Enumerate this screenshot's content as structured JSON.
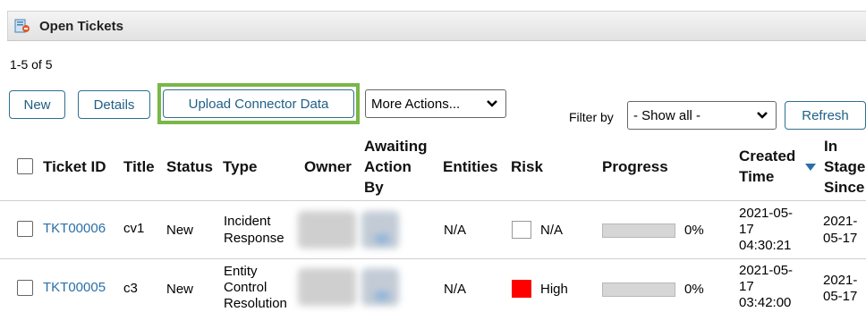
{
  "panel": {
    "title": "Open Tickets"
  },
  "count_text": "1-5 of 5",
  "toolbar": {
    "new_label": "New",
    "details_label": "Details",
    "upload_label": "Upload Connector Data",
    "more_actions_label": "More Actions...",
    "filter_label": "Filter by",
    "filter_value": "- Show all -",
    "refresh_label": "Refresh"
  },
  "table": {
    "headers": {
      "ticket_id": "Ticket ID",
      "title": "Title",
      "status": "Status",
      "type": "Type",
      "owner": "Owner",
      "awaiting_1": "Awaiting",
      "awaiting_2": "Action",
      "awaiting_3": "By",
      "entities": "Entities",
      "risk": "Risk",
      "progress": "Progress",
      "created_1": "Created",
      "created_2": "Time",
      "stage_1": "In",
      "stage_2": "Stage",
      "stage_3": "Since"
    },
    "rows": [
      {
        "ticket_id": "TKT00006",
        "title": "cv1",
        "status": "New",
        "type_1": "Incident",
        "type_2": "Response",
        "entities": "N/A",
        "risk": "N/A",
        "risk_color": "#ffffff",
        "progress": 0,
        "progress_text": "0%",
        "created_1": "2021-05-",
        "created_2": "17",
        "created_3": "04:30:21",
        "stage_1": "2021-",
        "stage_2": "05-17"
      },
      {
        "ticket_id": "TKT00005",
        "title": "c3",
        "status": "New",
        "type_1": "Entity",
        "type_2": "Control",
        "type_3": "Resolution",
        "entities": "N/A",
        "risk": "High",
        "risk_color": "#ff0000",
        "progress": 0,
        "progress_text": "0%",
        "created_1": "2021-05-",
        "created_2": "17",
        "created_3": "03:42:00",
        "stage_1": "2021-",
        "stage_2": "05-17"
      }
    ]
  },
  "colors": {
    "accent": "#7ab648",
    "link": "#2a6fa8",
    "button_border": "#2f6f8f"
  },
  "icons": {
    "panel": "tickets-icon",
    "sort": "sort-desc-icon",
    "dropdown": "chevron-down-icon"
  }
}
